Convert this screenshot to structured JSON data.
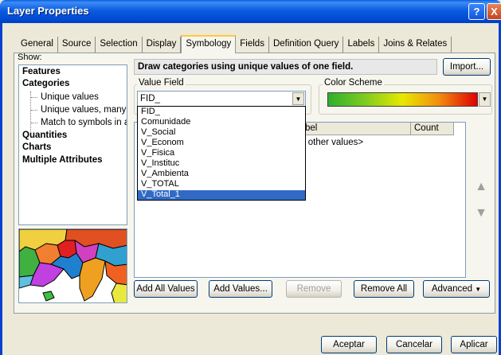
{
  "window": {
    "title": "Layer Properties",
    "help": "?",
    "close": "X"
  },
  "tabs": [
    "General",
    "Source",
    "Selection",
    "Display",
    "Symbology",
    "Fields",
    "Definition Query",
    "Labels",
    "Joins & Relates"
  ],
  "active_tab": "Symbology",
  "show": {
    "label": "Show:",
    "items": [
      "Features",
      "Categories",
      "Unique values",
      "Unique values, many f",
      "Match to symbols in a",
      "Quantities",
      "Charts",
      "Multiple Attributes"
    ]
  },
  "description": "Draw categories using unique values of one field.",
  "import_button": "Import...",
  "value_field": {
    "label": "Value Field",
    "selected": "FID_",
    "options": [
      "FID_",
      "Comunidade",
      "V_Social",
      "V_Econom",
      "V_Fisica",
      "V_Instituc",
      "V_Ambienta",
      "V_TOTAL",
      "V_Total_1"
    ],
    "highlighted": "V_Total_1"
  },
  "color_scheme": {
    "label": "Color Scheme",
    "colors": [
      "#2fae2f",
      "#7fcc1f",
      "#e8e800",
      "#f28a10",
      "#e00000"
    ]
  },
  "table": {
    "columns": [
      "Label",
      "Count"
    ],
    "column_visible_fragment": "bel",
    "rows": [
      {
        "label_fragment": "l other values>"
      }
    ]
  },
  "buttons": {
    "add_all": "Add All Values",
    "add_values": "Add Values...",
    "remove": "Remove",
    "remove_all": "Remove All",
    "advanced": "Advanced",
    "ok": "Aceptar",
    "cancel": "Cancelar",
    "apply": "Aplicar"
  },
  "icons": {
    "up": "up-arrow-icon",
    "down": "down-arrow-icon",
    "dropdown": "chevron-down-icon"
  }
}
